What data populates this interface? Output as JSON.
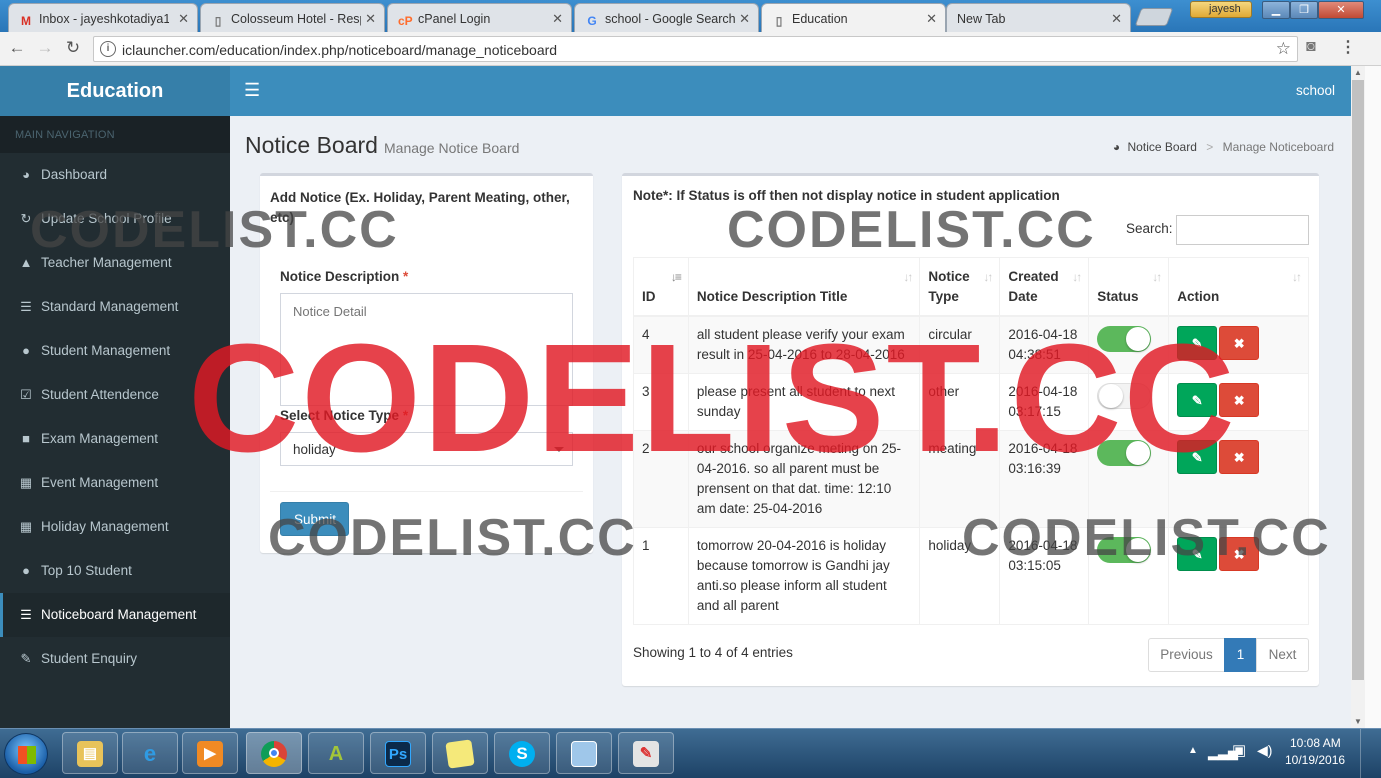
{
  "browser": {
    "tabs": [
      {
        "title": "Inbox - jayeshkotadiya1",
        "icon": "gmail-icon"
      },
      {
        "title": "Colosseum Hotel - Resp",
        "icon": "page-icon"
      },
      {
        "title": "cPanel Login",
        "icon": "cpanel-icon"
      },
      {
        "title": "school - Google Search",
        "icon": "google-icon"
      },
      {
        "title": "Education",
        "icon": "page-icon",
        "active": true
      },
      {
        "title": "New Tab",
        "icon": "none"
      }
    ],
    "user": "jayesh",
    "url": "iclauncher.com/education/index.php/noticeboard/manage_noticeboard"
  },
  "app": {
    "logo": "Education",
    "user": "school",
    "colors": {
      "header": "#3c8dbc",
      "logo_bg": "#367fa9",
      "sidebar": "#222d32",
      "success": "#00a65a",
      "danger": "#dd4b39"
    }
  },
  "sidebar": {
    "header": "MAIN NAVIGATION",
    "items": [
      {
        "label": "Dashboard",
        "icon": "dashboard-icon"
      },
      {
        "label": "Update School Profile",
        "icon": "refresh-icon"
      },
      {
        "label": "Teacher Management",
        "icon": "graduation-cap-icon"
      },
      {
        "label": "Standard Management",
        "icon": "list-icon"
      },
      {
        "label": "Student Management",
        "icon": "user-icon"
      },
      {
        "label": "Student Attendence",
        "icon": "calendar-check-icon"
      },
      {
        "label": "Exam Management",
        "icon": "briefcase-icon"
      },
      {
        "label": "Event Management",
        "icon": "calendar-icon"
      },
      {
        "label": "Holiday Management",
        "icon": "calendar-icon"
      },
      {
        "label": "Top 10 Student",
        "icon": "user-icon"
      },
      {
        "label": "Noticeboard Management",
        "icon": "list-icon",
        "active": true
      },
      {
        "label": "Student Enquiry",
        "icon": "edit-icon"
      }
    ]
  },
  "page": {
    "title": "Notice Board",
    "subtitle": "Manage Notice Board",
    "breadcrumb": [
      "Notice Board",
      "Manage Noticeboard"
    ]
  },
  "form": {
    "title": "Add Notice (Ex. Holiday, Parent Meating, other, etc)",
    "description_label": "Notice Description",
    "description_placeholder": "Notice Detail",
    "type_label": "Select Notice Type",
    "type_value": "holiday",
    "required_mark": "*",
    "submit": "Submit"
  },
  "list": {
    "note": "Note*: If Status is off then not display notice in student application",
    "search_label": "Search:",
    "columns": [
      "ID",
      "Notice Description Title",
      "Notice Type",
      "Created Date",
      "Status",
      "Action"
    ],
    "rows": [
      {
        "id": "4",
        "title": "all student please verify your exam result in 25-04-2016 to 28-04-2016",
        "type": "circular",
        "date": "2016-04-18 04:38:51",
        "status": "on"
      },
      {
        "id": "3",
        "title": "please present all student to next sunday",
        "type": "other",
        "date": "2016-04-18 03:17:15",
        "status": "off"
      },
      {
        "id": "2",
        "title": "our school organize meting on 25-04-2016. so all parent must be prensent on that dat. time: 12:10 am date: 25-04-2016",
        "type": "meating",
        "date": "2016-04-18 03:16:39",
        "status": "on"
      },
      {
        "id": "1",
        "title": "tomorrow 20-04-2016 is holiday because tomorrow is Gandhi jay anti.so please inform all student and all parent",
        "type": "holiday",
        "date": "2016-04-18 03:15:05",
        "status": "on"
      }
    ],
    "info": "Showing 1 to 4 of 4 entries",
    "pagination": {
      "previous": "Previous",
      "current": "1",
      "next": "Next"
    }
  },
  "watermark": {
    "text": "CODELIST.CC"
  },
  "taskbar": {
    "apps": [
      "explorer-icon",
      "ie-icon",
      "media-player-icon",
      "chrome-icon",
      "android-studio-icon",
      "photoshop-icon",
      "sticky-notes-icon",
      "skype-icon",
      "window-icon",
      "paint-icon"
    ],
    "photoshop_label": "Ps",
    "time": "10:08 AM",
    "date": "10/19/2016"
  }
}
